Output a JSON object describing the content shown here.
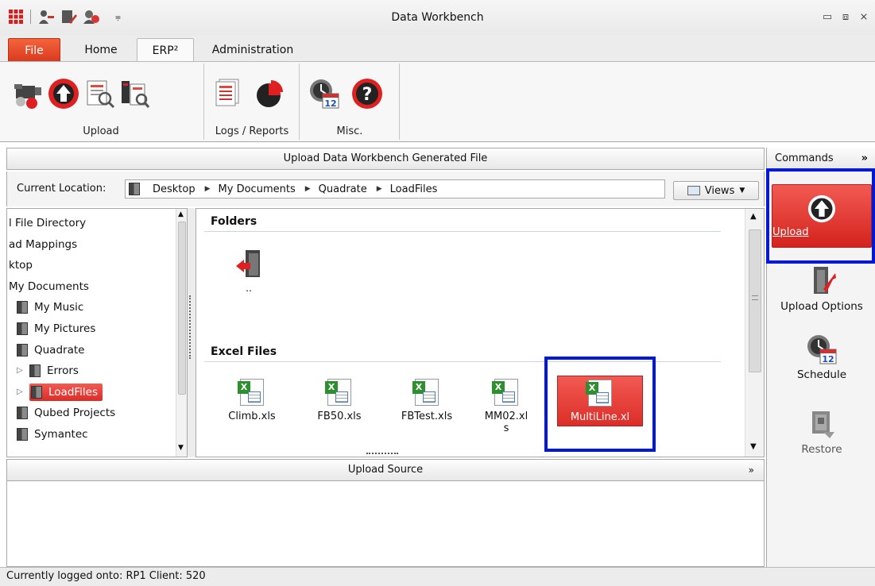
{
  "window": {
    "title": "Data Workbench",
    "controls": [
      "minimize-icon",
      "restore-icon",
      "close-icon"
    ],
    "qat_icons": [
      "app-grid-icon",
      "user-key-icon",
      "edit-doc-icon",
      "upload-person-icon",
      "dropdown-icon"
    ]
  },
  "tabs": [
    {
      "label": "File",
      "state": "file"
    },
    {
      "label": "Home",
      "state": ""
    },
    {
      "label": "ERP²",
      "state": "active"
    },
    {
      "label": "Administration",
      "state": ""
    }
  ],
  "ribbon": {
    "groups": [
      {
        "label": "Upload",
        "icons": [
          "video-camera-icon",
          "upload-arrow-icon",
          "search-document-icon",
          "search-list-icon"
        ]
      },
      {
        "label": "Logs / Reports",
        "icons": [
          "report-document-icon",
          "pie-chart-icon"
        ]
      },
      {
        "label": "Misc.",
        "icons": [
          "calendar-clock-icon",
          "help-icon"
        ]
      }
    ]
  },
  "main": {
    "header": "Upload Data Workbench Generated File",
    "location_label": "Current Location:",
    "breadcrumbs": [
      "Desktop",
      "My Documents",
      "Quadrate",
      "LoadFiles"
    ],
    "views_label": "Views"
  },
  "tree": {
    "items": [
      {
        "label": "l File Directory",
        "indent": 0,
        "icon": false,
        "expander": "",
        "selected": false
      },
      {
        "label": "ad Mappings",
        "indent": 0,
        "icon": false,
        "expander": "",
        "selected": false
      },
      {
        "label": "ktop",
        "indent": 0,
        "icon": false,
        "expander": "",
        "selected": false
      },
      {
        "label": "My Documents",
        "indent": 0,
        "icon": false,
        "expander": "",
        "selected": false
      },
      {
        "label": "My Music",
        "indent": 1,
        "icon": true,
        "expander": "",
        "selected": false
      },
      {
        "label": "My Pictures",
        "indent": 1,
        "icon": true,
        "expander": "",
        "selected": false
      },
      {
        "label": "Quadrate",
        "indent": 1,
        "icon": true,
        "expander": "",
        "selected": false
      },
      {
        "label": "Errors",
        "indent": 2,
        "icon": true,
        "expander": "▷",
        "selected": false
      },
      {
        "label": "LoadFiles",
        "indent": 2,
        "icon": true,
        "expander": "▷",
        "selected": true
      },
      {
        "label": "Qubed Projects",
        "indent": 1,
        "icon": true,
        "expander": "",
        "selected": false
      },
      {
        "label": "Symantec",
        "indent": 1,
        "icon": true,
        "expander": "",
        "selected": false
      }
    ]
  },
  "files": {
    "folders_title": "Folders",
    "parent_folder_label": "..",
    "excel_title": "Excel Files",
    "excel_files": [
      {
        "name": "Climb.xls",
        "selected": false
      },
      {
        "name": "FB50.xls",
        "selected": false
      },
      {
        "name": "FBTest.xls",
        "selected": false
      },
      {
        "name": "MM02.xls",
        "selected": false
      },
      {
        "name": "MultiLine.xl",
        "selected": true
      }
    ]
  },
  "upload_source": {
    "title": "Upload Source"
  },
  "commands": {
    "title": "Commands",
    "expand_glyph": "»",
    "items": [
      {
        "label": "Upload",
        "icon": "upload-arrow-icon",
        "active": true
      },
      {
        "label": "Upload Options",
        "icon": "folder-wrench-icon",
        "active": false
      },
      {
        "label": "Schedule",
        "icon": "calendar-clock-icon",
        "active": false
      },
      {
        "label": "Restore",
        "icon": "restore-icon",
        "active": false
      }
    ]
  },
  "status": {
    "text": "Currently logged onto: RP1 Client: 520"
  },
  "colors": {
    "accent_red": "#dc2d28",
    "highlight_blue": "#0018d8",
    "file_tab": "#e04422"
  }
}
